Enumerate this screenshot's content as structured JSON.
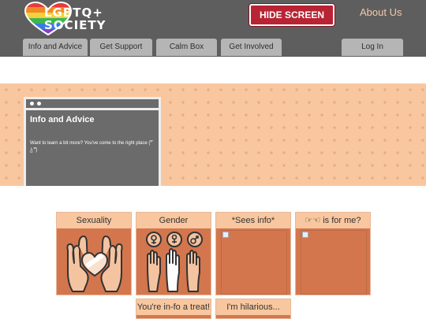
{
  "header": {
    "logo_line1": "LGBTQ+",
    "logo_line2": "SOCIETY",
    "hide_screen": "HIDE SCREEN",
    "about": "About Us"
  },
  "nav": {
    "tabs": [
      "Info and Advice",
      "Get Support",
      "Calm Box",
      "Get Involved"
    ],
    "login": "Log In"
  },
  "panel": {
    "title": "Info and Advice",
    "text": "Want to learn a bit more? You've come to the right place (͡° ͜ʖ ͡°)"
  },
  "cards": [
    {
      "label": "Sexuality",
      "icon": "hands-heart-icon"
    },
    {
      "label": "Gender",
      "icon": "raised-hands-gender-icon"
    },
    {
      "label": "*Sees info*",
      "icon": "broken-image-icon"
    },
    {
      "label": "☞☜ is for me?",
      "icon": "broken-image-icon"
    }
  ],
  "cards_row2": [
    {
      "label": "You're in-fo a treat!"
    },
    {
      "label": "I'm hilarious..."
    }
  ],
  "colors": {
    "header_bg": "#5e5e5e",
    "hide_button": "#b82433",
    "accent": "#d4764d",
    "banner": "#f9c79f"
  }
}
